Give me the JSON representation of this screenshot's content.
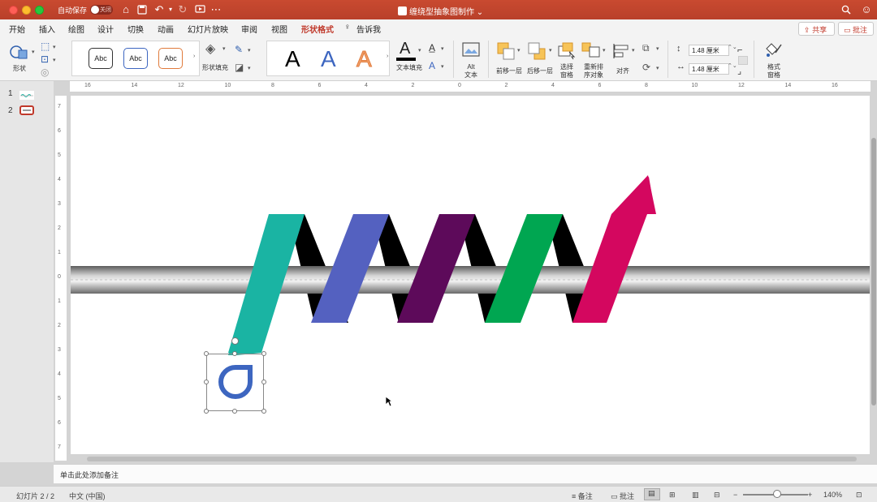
{
  "titlebar": {
    "autosave_label": "自动保存",
    "autosave_state": "关闭",
    "doc_title": "缠绕型抽象图制作",
    "color": "#c0392b"
  },
  "tabs": [
    "开始",
    "插入",
    "绘图",
    "设计",
    "切换",
    "动画",
    "幻灯片放映",
    "审阅",
    "视图",
    "形状格式"
  ],
  "tell_me": "告诉我",
  "share_label": "共享",
  "comment_label": "批注",
  "ribbon": {
    "shape_label": "形状",
    "style_samples": [
      "Abc",
      "Abc",
      "Abc"
    ],
    "shape_fill_label": "形状填充",
    "text_samples": [
      "A",
      "A",
      "A"
    ],
    "text_fill_label": "文本填充",
    "alt_text_label": [
      "Alt",
      "文本"
    ],
    "bring_forward_label": "前移一层",
    "send_backward_label": "后移一层",
    "selection_pane_label": [
      "选择",
      "窗格"
    ],
    "reorder_label": [
      "重新排",
      "序对象"
    ],
    "align_label": "对齐",
    "height_value": "1.48 厘米",
    "width_value": "1.48 厘米",
    "format_pane_label": [
      "格式",
      "窗格"
    ]
  },
  "ruler": {
    "h_ticks": [
      "16",
      "14",
      "12",
      "10",
      "8",
      "6",
      "4",
      "2",
      "0",
      "2",
      "4",
      "6",
      "8",
      "10",
      "12",
      "14",
      "16"
    ],
    "v_ticks": [
      "7",
      "6",
      "5",
      "4",
      "3",
      "2",
      "1",
      "0",
      "1",
      "2",
      "3",
      "4",
      "5",
      "6",
      "7"
    ]
  },
  "thumbnails": [
    "1",
    "2"
  ],
  "slide": {
    "stripe_colors": [
      "#1ab4a3",
      "#5461c0",
      "#5d0a5a",
      "#00a651",
      "#d4075f"
    ],
    "selected_icon_color": "#3d66c0"
  },
  "notes_placeholder": "单击此处添加备注",
  "status": {
    "slide_indicator": "幻灯片 2 / 2",
    "language": "中文 (中国)",
    "notes_label": "备注",
    "comments_label": "批注",
    "zoom": "140%"
  }
}
